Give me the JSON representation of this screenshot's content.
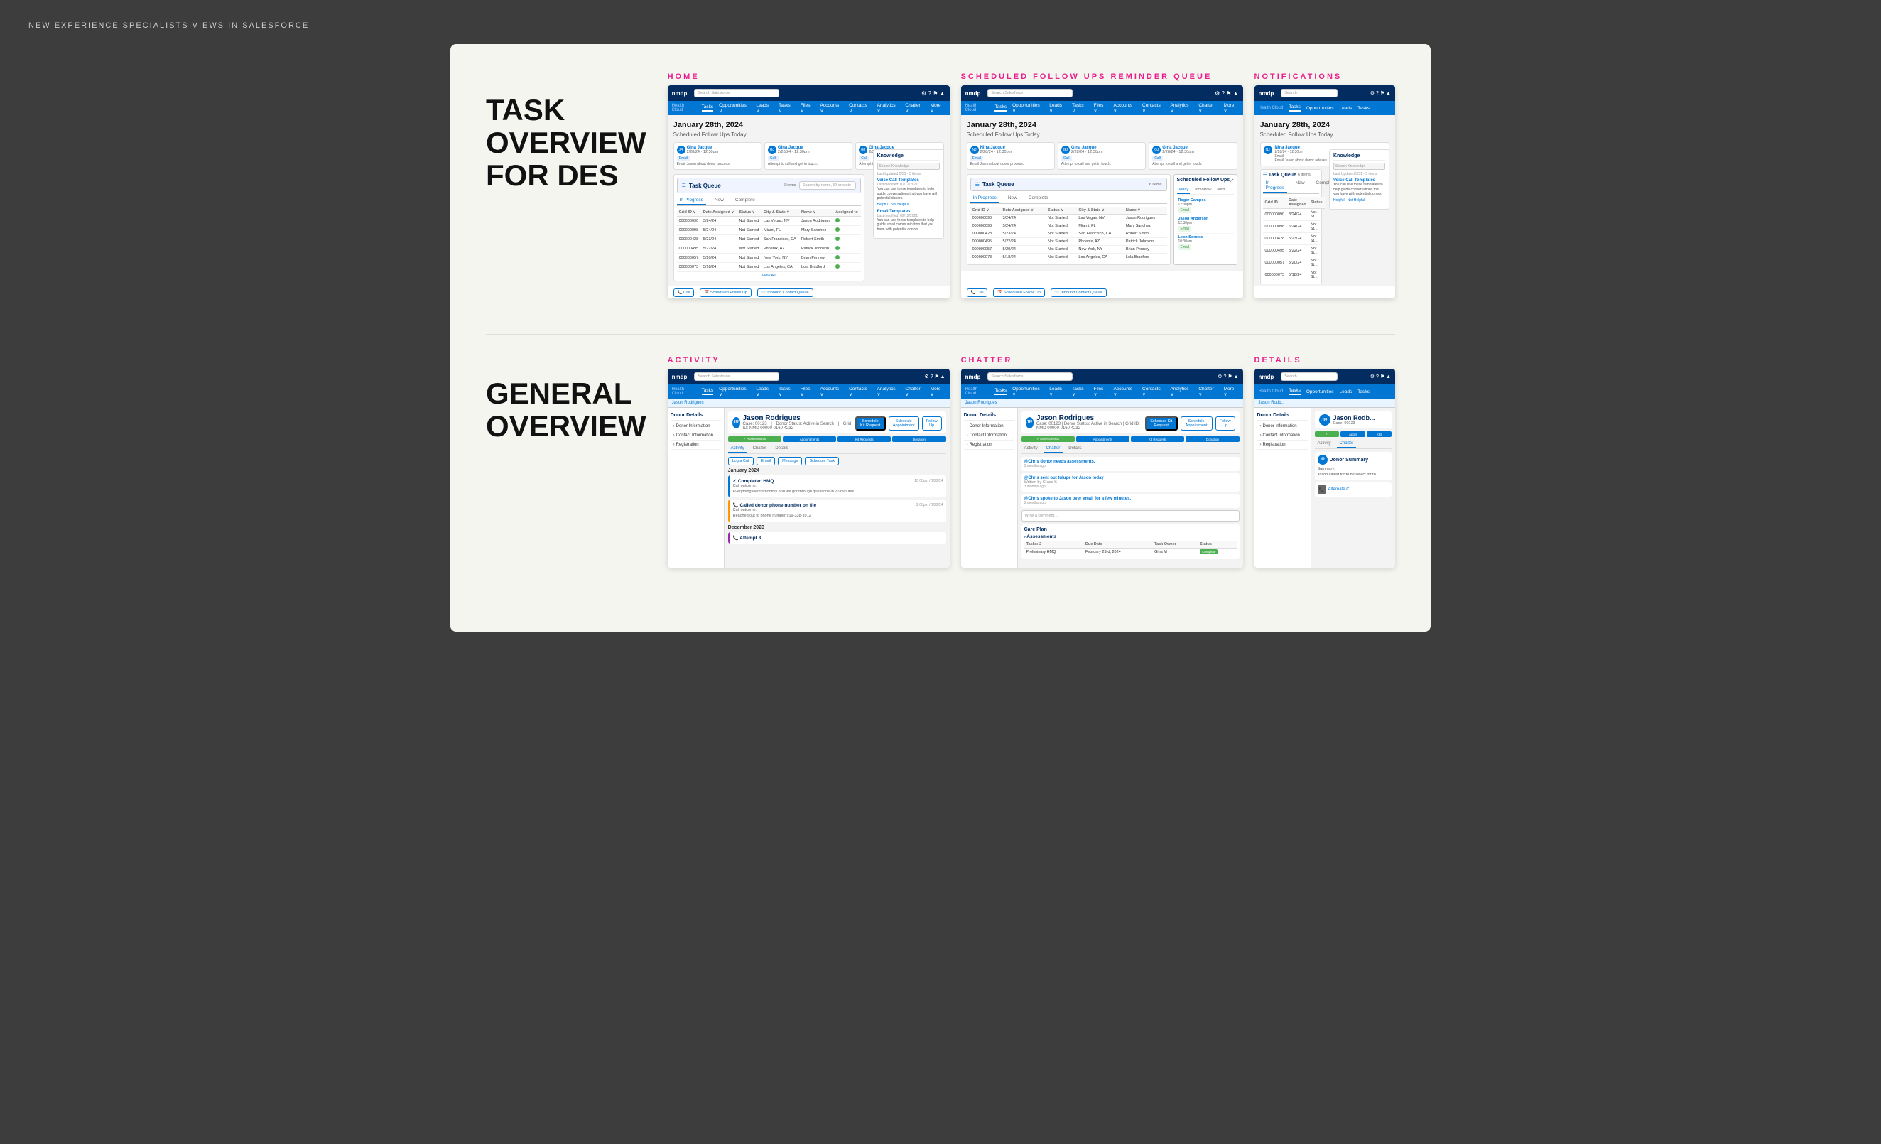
{
  "topbar": {
    "title": "NEW EXPERIENCE SPECIALISTS VIEWS IN SALESFORCE"
  },
  "taskSection": {
    "title": "TASK\nOVERVIEW\nFOR DES",
    "subsections": {
      "home": {
        "label": "HOME",
        "date": "January 28th, 2024",
        "subtitle": "Scheduled Follow Ups Today"
      },
      "scheduledQueue": {
        "label": "SCHEDULED FOLLOW UPS REMINDER QUEUE",
        "date": "January 28th, 2024",
        "subtitle": "Scheduled Follow Ups Today"
      },
      "notifications": {
        "label": "NOTIFICATIONS",
        "date": "January 28th, 2024",
        "subtitle": "Scheduled Follow Ups Today"
      }
    },
    "knowledge": {
      "title": "Knowledge",
      "searchPlaceholder": "Search Knowledge",
      "lastUpdated": "Last Updated 5/31 · 3 items",
      "voiceCallTemplates": "Voice Call Templates",
      "voiceLastModified": "Last modified: 02/12/2021",
      "voiceDesc": "You can use these templates to help guide conversations that you have with potential donors.",
      "helpful": "Helpful",
      "notHelpful": "Not Helpful",
      "emailTemplates": "Email Templates",
      "emailLastModified": "Last modified: 02/12/2021",
      "emailDesc": "You can use these templates to help guide email communication that you have with potential donors."
    },
    "scheduledFollowUps": {
      "title": "Scheduled Follow Ups",
      "tabs": [
        "Today",
        "Tomorrow",
        "Next"
      ],
      "items": [
        {
          "name": "Roger Campos",
          "time": "12:30pm",
          "action": "Email"
        },
        {
          "name": "Jason Anderson",
          "time": "12:30pm",
          "action": "Email"
        },
        {
          "name": "Leon Somers",
          "time": "10:30am",
          "action": "Email"
        }
      ]
    },
    "tasks": [
      {
        "id": "000000090",
        "date": "3/24/24",
        "status": "Not Started",
        "city": "Las Vegas, NV",
        "name": "Jason Rodrigues"
      },
      {
        "id": "000000098",
        "date": "5/24/24",
        "status": "Not Started",
        "city": "Miami, FL",
        "name": "Mary Sanchez"
      },
      {
        "id": "000000428",
        "date": "5/23/24",
        "status": "Not Started",
        "city": "San Francisco, CA",
        "name": "Robert Smith"
      },
      {
        "id": "000000495",
        "date": "5/22/24",
        "status": "Not Started",
        "city": "Phoenix, AZ",
        "name": "Patrick Johnson"
      },
      {
        "id": "000000057",
        "date": "5/20/24",
        "status": "Not Started",
        "city": "New York, NY",
        "name": "Brian Penney"
      },
      {
        "id": "000000073",
        "date": "5/18/24",
        "status": "Not Started",
        "city": "Los Angeles, CA",
        "name": "Lola Bradford"
      }
    ],
    "scheduledTasks": [
      {
        "id": "000000090",
        "date": "3/24/24",
        "status": "Not Started",
        "city": "Las Vegas, NV"
      },
      {
        "id": "000000098",
        "date": "5/24/24",
        "status": "Not Started",
        "city": "Miami, FL"
      },
      {
        "id": "000000428",
        "date": "5/23/24",
        "status": "Not Started",
        "city": "San Francisco, CA"
      },
      {
        "id": "000000495",
        "date": "5/22/24",
        "status": "Not Started",
        "city": "Phoenix, AZ"
      },
      {
        "id": "000000057",
        "date": "5/20/24",
        "status": "Not Started",
        "city": "New York, NY"
      },
      {
        "id": "000000073",
        "date": "5/18/24",
        "status": "Not Started",
        "city": "Los Angeles, CA"
      }
    ]
  },
  "generalSection": {
    "title": "GENERAL\nOVERVIEW",
    "subsections": {
      "activity": {
        "label": "ACTIVITY"
      },
      "chatter": {
        "label": "CHATTER"
      },
      "details": {
        "label": "DETAILS"
      }
    },
    "donor": {
      "name": "Jason Rodrigues",
      "type": "Donor",
      "case": "00123",
      "status": "Active in Search",
      "gridId": "NMD 00000 0160 4232"
    },
    "sidebar": [
      "Donor Information",
      "Contact Information",
      "Registration"
    ],
    "progressSteps": [
      "Assessments",
      "Appointments",
      "Kit Requests",
      "Donation"
    ],
    "tabs": [
      "Activity",
      "Chatter",
      "Details"
    ],
    "activities": [
      {
        "type": "Completed HMQ",
        "time": "10:00pm / 1/29/24",
        "desc": "Call outcome:\nEverything went smoothly and we got through questions in 20 minutes."
      },
      {
        "type": "Called donor phone number on file",
        "time": "2:00pm / 1/29/24",
        "desc": "Call outcome:\nReached out to phone number 919-338-3912"
      }
    ],
    "chatterItems": [
      {
        "author": "@Chris donor needs assessments.",
        "time": "3 months ago"
      },
      {
        "author": "@Chris sent out tulupe for Jason today",
        "desc": "Written by Grace K",
        "time": "3 months ago"
      },
      {
        "author": "@Chris spoke to Jason over email for a few minutes.",
        "time": "3 months ago"
      }
    ],
    "carePlan": {
      "title": "Care Plan",
      "assessments": "Assessments",
      "taskLabel": "Tasks: 2",
      "dueDate": "February 23rd, 2024",
      "taskOwner": "Gina M",
      "status": "Complete"
    }
  },
  "nav": {
    "items": [
      "Tasks",
      "Opportunities",
      "Leads",
      "Tasks",
      "Files",
      "Accounts",
      "Contacts",
      "Analytics",
      "Chatter",
      "More"
    ]
  },
  "colors": {
    "salesforceBlue": "#0176d3",
    "salesforceDark": "#032d60",
    "pink": "#e91e8c",
    "lightBlue": "#5b9bd5",
    "green": "#4caf50",
    "progressGreen": "#4caf50",
    "progressBlue": "#0176d3"
  }
}
